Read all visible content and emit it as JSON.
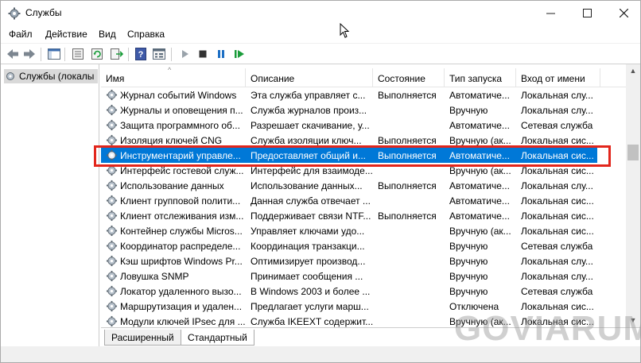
{
  "window": {
    "title": "Службы",
    "app_icon": "services-gear-icon",
    "controls": [
      "minimize",
      "maximize",
      "close"
    ]
  },
  "menu": {
    "items": [
      "Файл",
      "Действие",
      "Вид",
      "Справка"
    ]
  },
  "toolbar": {
    "icons": [
      "back-arrow-icon",
      "forward-arrow-icon",
      "console-tree-icon",
      "properties-icon",
      "refresh-icon",
      "export-list-icon",
      "help-icon",
      "view-icon",
      "play-icon",
      "stop-icon",
      "pause-icon",
      "restart-icon"
    ],
    "accent": "#1a9c3a"
  },
  "tree": {
    "selected_item": "Службы (локалы"
  },
  "list": {
    "columns": [
      "Имя",
      "Описание",
      "Состояние",
      "Тип запуска",
      "Вход от имени"
    ],
    "rows": [
      {
        "name": "Журнал событий Windows",
        "desc": "Эта служба управляет с...",
        "status": "Выполняется",
        "start": "Автоматиче...",
        "logon": "Локальная слу..."
      },
      {
        "name": "Журналы и оповещения п...",
        "desc": "Служба журналов произ...",
        "status": "",
        "start": "Вручную",
        "logon": "Локальная слу..."
      },
      {
        "name": "Защита программного об...",
        "desc": "Разрешает скачивание, у...",
        "status": "",
        "start": "Автоматиче...",
        "logon": "Сетевая служба"
      },
      {
        "name": "Изоляция ключей CNG",
        "desc": "Служба изоляции ключ...",
        "status": "Выполняется",
        "start": "Вручную (ак...",
        "logon": "Локальная сис..."
      },
      {
        "name": "Инструментарий управле...",
        "desc": "Предоставляет общий и...",
        "status": "Выполняется",
        "start": "Автоматиче...",
        "logon": "Локальная сис...",
        "selected": true
      },
      {
        "name": "Интерфейс гостевой служ...",
        "desc": "Интерфейс для взаимоде...",
        "status": "",
        "start": "Вручную (ак...",
        "logon": "Локальная сис..."
      },
      {
        "name": "Использование данных",
        "desc": "Использование данных...",
        "status": "Выполняется",
        "start": "Автоматиче...",
        "logon": "Локальная слу..."
      },
      {
        "name": "Клиент групповой полити...",
        "desc": "Данная служба отвечает ...",
        "status": "",
        "start": "Автоматиче...",
        "logon": "Локальная сис..."
      },
      {
        "name": "Клиент отслеживания изм...",
        "desc": "Поддерживает связи NTF...",
        "status": "Выполняется",
        "start": "Автоматиче...",
        "logon": "Локальная сис..."
      },
      {
        "name": "Контейнер службы Micros...",
        "desc": "Управляет ключами удо...",
        "status": "",
        "start": "Вручную (ак...",
        "logon": "Локальная сис..."
      },
      {
        "name": "Координатор распределе...",
        "desc": "Координация транзакци...",
        "status": "",
        "start": "Вручную",
        "logon": "Сетевая служба"
      },
      {
        "name": "Кэш шрифтов Windows Pr...",
        "desc": "Оптимизирует производ...",
        "status": "",
        "start": "Вручную",
        "logon": "Локальная слу..."
      },
      {
        "name": "Ловушка SNMP",
        "desc": "Принимает сообщения ...",
        "status": "",
        "start": "Вручную",
        "logon": "Локальная слу..."
      },
      {
        "name": "Локатор удаленного вызо...",
        "desc": "В Windows 2003 и более ...",
        "status": "",
        "start": "Вручную",
        "logon": "Сетевая служба"
      },
      {
        "name": "Маршрутизация и удален...",
        "desc": "Предлагает услуги марш...",
        "status": "",
        "start": "Отключена",
        "logon": "Локальная сис..."
      },
      {
        "name": "Модули ключей IPsec для ...",
        "desc": "Служба IKEEXT содержит...",
        "status": "",
        "start": "Вручную (ак...",
        "logon": "Локальная сис..."
      }
    ],
    "selection_color": "#0078d7",
    "highlight_color": "#e2261c"
  },
  "tabs": {
    "items": [
      "Расширенный",
      "Стандартный"
    ],
    "active": "Стандартный"
  },
  "watermark": "GOVIARUM"
}
